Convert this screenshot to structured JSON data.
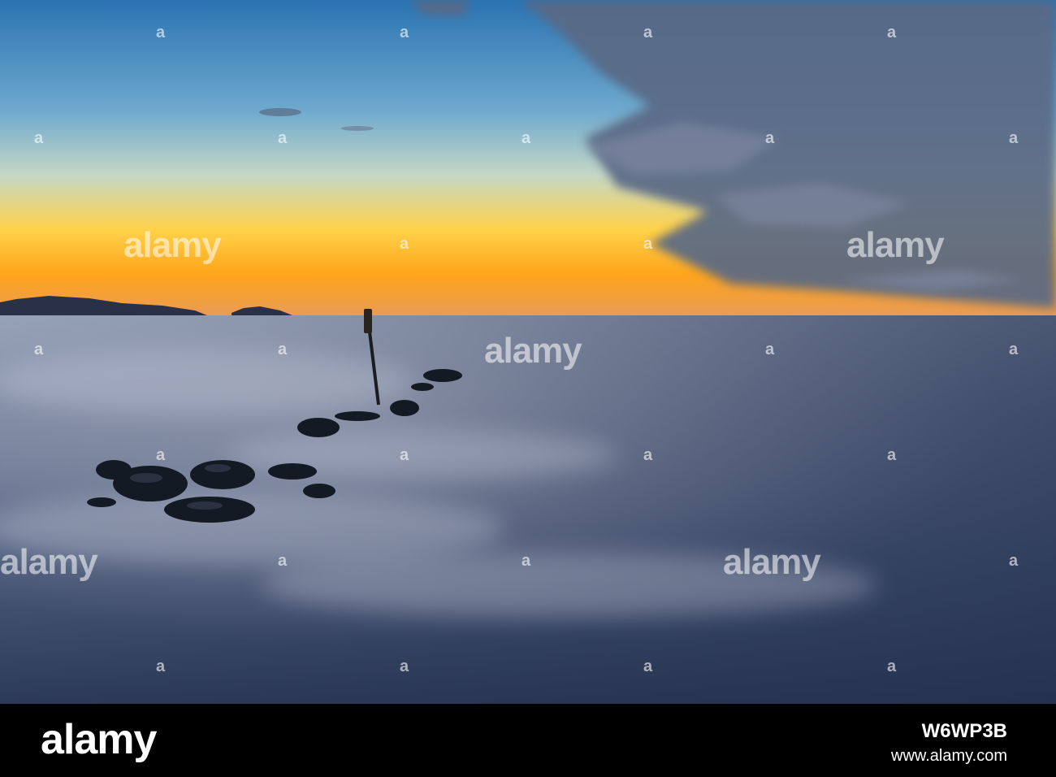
{
  "image": {
    "subject": "long-exposure sunset over calm sea with rocks and a wooden post",
    "colors": {
      "sky_top": "#2f7bb6",
      "sky_mid": "#9cc3d0",
      "horizon_glow": "#ffb21e",
      "sea": "#5a6a86",
      "sea_dark": "#2c3a58",
      "rocks": "#151a22",
      "clouds": "#5d6d86"
    }
  },
  "watermark": {
    "logo_text": "alamy",
    "small_mark": "a"
  },
  "footer": {
    "logo": "alamy",
    "image_id": "W6WP3B",
    "url": "www.alamy.com"
  }
}
